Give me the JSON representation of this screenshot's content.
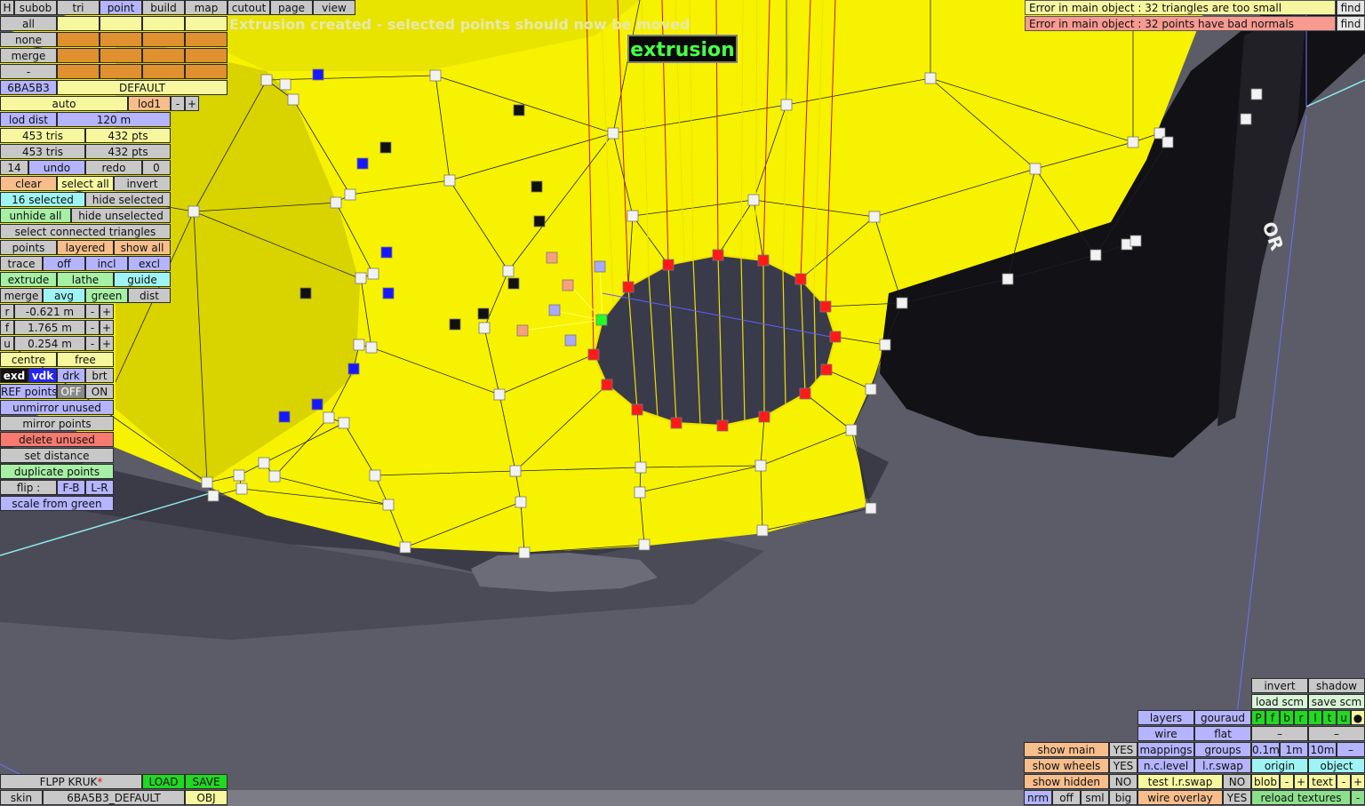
{
  "toolbar": {
    "h": "H",
    "tabs": [
      "subob",
      "tri",
      "point",
      "build",
      "map",
      "cutout",
      "page",
      "view"
    ]
  },
  "status_message": "Extrusion created - selected points should now be moved",
  "mode_badge": "extrusion",
  "errors": [
    {
      "text": "Error in main object : 32 triangles are too small",
      "find": "find"
    },
    {
      "text": "Error in main object : 32 points have bad normals",
      "find": "find"
    }
  ],
  "left": {
    "all": "all",
    "none": "none",
    "merge": "merge",
    "minus": "-",
    "object_id": "6BA5B3",
    "default": "DEFAULT",
    "auto": "auto",
    "lod1": "lod1",
    "minus2": "-",
    "plus": "+",
    "lod_dist": "lod dist",
    "lod_dist_value": "120 m",
    "tris1": "453 tris",
    "pts1": "432 pts",
    "tris2": "453 tris",
    "pts2": "432 pts",
    "undo_count": "14",
    "undo": "undo",
    "redo": "redo",
    "redo_count": "0",
    "clear": "clear",
    "select_all": "select all",
    "invert": "invert",
    "selected": "16 selected",
    "hide_selected": "hide selected",
    "unhide_all": "unhide all",
    "hide_unselected": "hide unselected",
    "select_connected": "select connected triangles",
    "points": "points",
    "layered": "layered",
    "show_all": "show all",
    "trace": "trace",
    "off": "off",
    "incl": "incl",
    "excl": "excl",
    "extrude": "extrude",
    "lathe": "lathe",
    "guide": "guide",
    "merge2": "merge",
    "avg": "avg",
    "green": "green",
    "dist": "dist",
    "r": "r",
    "r_val": "-0.621 m",
    "f": "f",
    "f_val": "1.765 m",
    "u": "u",
    "u_val": "0.254 m",
    "pm_minus": "-",
    "pm_plus": "+",
    "centre": "centre",
    "free": "free",
    "exd": "exd",
    "vdk": "vdk",
    "drk": "drk",
    "brt": "brt",
    "ref_points": "REF points",
    "ref_off": "OFF",
    "ref_on": "ON",
    "unmirror_unused": "unmirror unused",
    "mirror_points": "mirror points",
    "delete_unused": "delete unused",
    "set_distance": "set distance",
    "duplicate_points": "duplicate points",
    "flip": "flip :",
    "flip_fb": "F-B",
    "flip_lr": "L-R",
    "scale_from_green": "scale from green"
  },
  "bottom_left": {
    "file": "FLPP KRUK",
    "file_mark": "*",
    "load": "LOAD",
    "save": "SAVE",
    "skin": "skin",
    "skin_name": "6BA5B3_DEFAULT",
    "obj": "OBJ"
  },
  "bottom_right": {
    "invert": "invert",
    "shadow": "shadow",
    "load_scm": "load scm",
    "save_scm": "save scm",
    "letters": [
      "P",
      "f",
      "b",
      "r",
      "l",
      "t",
      "u",
      "●"
    ],
    "layers": "layers",
    "gouraud": "gouraud",
    "wire": "wire",
    "flat": "flat",
    "dash1": "–",
    "dash2": "–",
    "show_main": "show main",
    "yes1": "YES",
    "mappings": "mappings",
    "groups": "groups",
    "s01": "0.1m",
    "s1": "1m",
    "s10": "10m",
    "sminus": "–",
    "show_wheels": "show wheels",
    "yes2": "YES",
    "nc_level": "n.c.level",
    "lr_swap": "l.r.swap",
    "origin": "origin",
    "object": "object",
    "show_hidden": "show hidden",
    "no1": "NO",
    "test_lr_swap": "test l.r.swap",
    "no2": "NO",
    "blob": "blob",
    "bminus": "-",
    "bplus": "+",
    "text": "text",
    "tminus": "-",
    "tplus": "+",
    "nrm": "nrm",
    "off": "off",
    "sml": "sml",
    "big": "big",
    "wire_overlay": "wire overlay",
    "yes3": "YES",
    "reload_textures": "reload textures",
    "rminus": "-"
  },
  "colors": {
    "mesh": "#f7f200",
    "accent": "#b4b4ff",
    "selected_point": "#ff2020",
    "green_point": "#22ff22"
  }
}
